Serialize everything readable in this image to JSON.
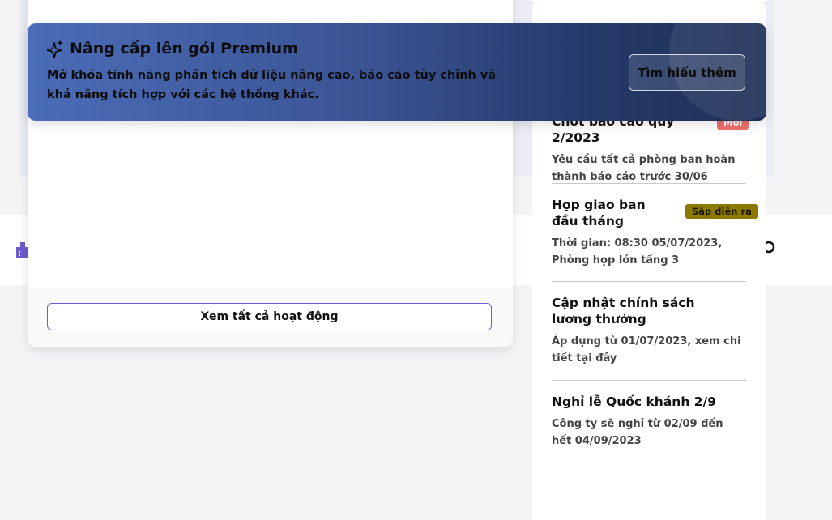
{
  "activity": {
    "view_all_label": "Xem tất cả hoạt động"
  },
  "premium": {
    "title": "Nâng cấp lên gói Premium",
    "description": "Mở khóa tính năng phân tích dữ liệu nâng cao, báo cáo tùy chỉnh và khả năng tích hợp với các hệ thống khác.",
    "button_label": "Tìm hiểu thêm",
    "icon": "sparkle-icon"
  },
  "notices": [
    {
      "title": "Chốt báo cáo quý 2/2023",
      "badge": "Mới",
      "description": "Yêu cầu tất cả phòng ban hoàn thành báo cáo trước 30/06"
    },
    {
      "title": "Họp giao ban đầu tháng",
      "badge": "Sắp diễn ra",
      "description": "Thời gian: 08:30 05/07/2023, Phòng họp lớn tầng 3"
    },
    {
      "title": "Cập nhật chính sách lương thưởng",
      "description": "Áp dụng từ 01/07/2023, xem chi tiết tại đây"
    },
    {
      "title": "Nghỉ lễ Quốc khánh 2/9",
      "description": "Công ty sẽ nghỉ từ 02/09 đến hết 04/09/2023"
    }
  ],
  "colors": {
    "accent": "#6d5bd0",
    "badge_new": "#ef6f6c",
    "badge_soon": "#8c7a00",
    "premium_start": "#4b6cb7",
    "premium_end": "#1f2f57"
  }
}
